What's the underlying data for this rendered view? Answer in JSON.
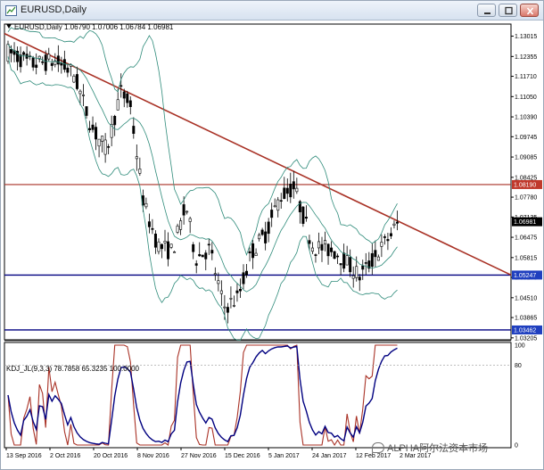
{
  "window": {
    "title": "EURUSD,Daily"
  },
  "chart_header": "EURUSD,Daily  1.06790 1.07006 1.06784 1.06981",
  "indicator_header": "KDJ_JL(9,3,3) 78.7858 65.3235 100.0000",
  "price_axis": [
    "1.13015",
    "1.12355",
    "1.11710",
    "1.11050",
    "1.10390",
    "1.09745",
    "1.09085",
    "1.08425",
    "1.07780",
    "1.07135",
    "1.06475",
    "1.05815",
    "1.05170",
    "1.04510",
    "1.03865",
    "1.03205"
  ],
  "price_range": [
    1.032,
    1.1335
  ],
  "highlight_labels": [
    {
      "text": "1.08190",
      "price": 1.0819,
      "color": "#c0392b"
    },
    {
      "text": "1.06981",
      "price": 1.06981,
      "color": "#000000"
    },
    {
      "text": "1.05247",
      "price": 1.05247,
      "color": "#1f3fbf"
    },
    {
      "text": "1.03462",
      "price": 1.03462,
      "color": "#1f3fbf"
    }
  ],
  "indicator_axis": [
    "100",
    "80",
    "0"
  ],
  "date_axis": [
    "13 Sep 2016",
    "2 Oct 2016",
    "20 Oct 2016",
    "8 Nov 2016",
    "27 Nov 2016",
    "15 Dec 2016",
    "5 Jan 2017",
    "24 Jan 2017",
    "12 Feb 2017",
    "2 Mar 2017"
  ],
  "watermark": "ALPHA阿尔法资本市场",
  "colors": {
    "resistance": "#a93226",
    "support": "#000080",
    "bands": "#2e8b7a",
    "k_line": "#000080",
    "d_line": "#a93226"
  }
}
